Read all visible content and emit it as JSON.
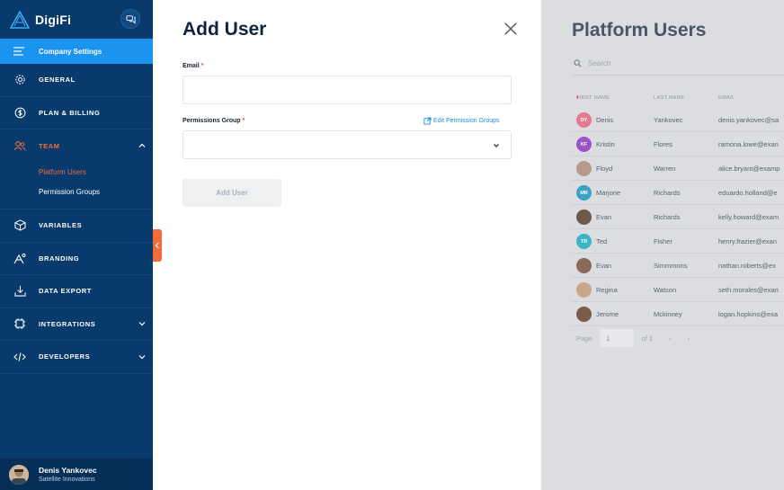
{
  "brand": {
    "name": "DigiFi"
  },
  "sidebar": {
    "company_settings": "Company Settings",
    "items": [
      {
        "label": "GENERAL",
        "icon": "gear-icon"
      },
      {
        "label": "PLAN & BILLING",
        "icon": "dollar-icon"
      }
    ],
    "team": {
      "label": "TEAM",
      "sub_items": [
        "Platform Users",
        "Permission Groups"
      ]
    },
    "lower_items": [
      {
        "label": "VARIABLES",
        "icon": "cube-icon"
      },
      {
        "label": "BRANDING",
        "icon": "branding-icon"
      },
      {
        "label": "DATA EXPORT",
        "icon": "download-icon"
      },
      {
        "label": "INTEGRATIONS",
        "icon": "chip-icon"
      },
      {
        "label": "DEVELOPERS",
        "icon": "code-icon"
      }
    ],
    "user": {
      "name": "Denis Yankovec",
      "company": "Satellite Innovations"
    }
  },
  "modal": {
    "title": "Add User",
    "email_label": "Email",
    "permissions_label": "Permissions Group",
    "required_mark": "*",
    "edit_link": "Edit Permission Groups",
    "submit_label": "Add User",
    "email_value": "",
    "permissions_value": ""
  },
  "background": {
    "title": "Platform Users",
    "search_placeholder": "Search",
    "columns": [
      "FIRST NAME",
      "LAST NAME",
      "EMAIL"
    ],
    "rows": [
      {
        "initials": "DY",
        "first": "Denis",
        "last": "Yankovec",
        "email": "denis.yankovec@sa",
        "color": "#e57b8f"
      },
      {
        "initials": "KF",
        "first": "Kristin",
        "last": "Flores",
        "email": "ramona.lowe@exan",
        "color": "#9a55c8"
      },
      {
        "initials": "",
        "first": "Floyd",
        "last": "Warren",
        "email": "alice.bryant@examp",
        "color": "#b89a8c"
      },
      {
        "initials": "MR",
        "first": "Marjorie",
        "last": "Richards",
        "email": "eduardo.holland@e",
        "color": "#39a2c8"
      },
      {
        "initials": "",
        "first": "Evan",
        "last": "Richards",
        "email": "kelly.howard@exam",
        "color": "#6e5a4a"
      },
      {
        "initials": "TR",
        "first": "Ted",
        "last": "Fisher",
        "email": "henry.frazier@exan",
        "color": "#3cb3c7"
      },
      {
        "initials": "",
        "first": "Evan",
        "last": "Simmmons",
        "email": "nathan.roberts@ex",
        "color": "#8a6a5a"
      },
      {
        "initials": "",
        "first": "Regina",
        "last": "Watson",
        "email": "seth.morales@exan",
        "color": "#c9a58a"
      },
      {
        "initials": "",
        "first": "Jerome",
        "last": "Mckinney",
        "email": "logan.hopkins@exa",
        "color": "#7a5a48"
      }
    ],
    "pager": {
      "label": "Page",
      "current": "1",
      "of": "of 1"
    }
  }
}
